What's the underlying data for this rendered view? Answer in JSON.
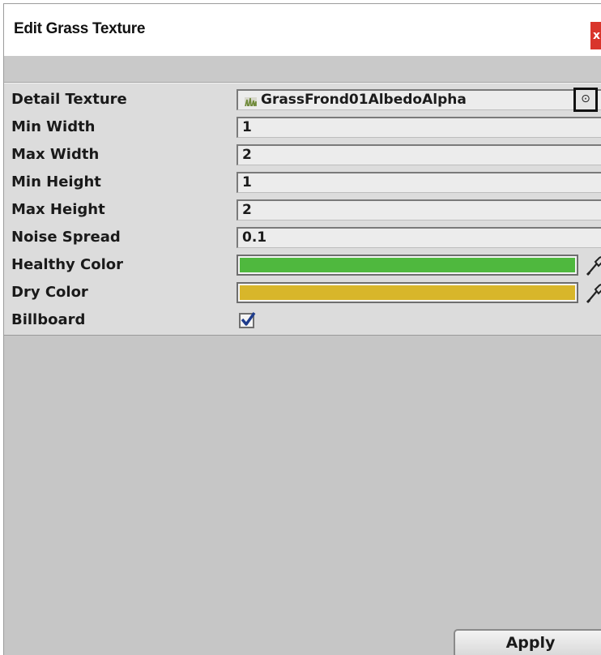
{
  "window": {
    "title": "Edit Grass Texture",
    "close_label": "x"
  },
  "properties": {
    "detail_texture": {
      "label": "Detail Texture",
      "value": "GrassFrond01AlbedoAlpha",
      "picker_icon": "object-picker-icon"
    },
    "min_width": {
      "label": "Min Width",
      "value": "1"
    },
    "max_width": {
      "label": "Max Width",
      "value": "2"
    },
    "min_height": {
      "label": "Min Height",
      "value": "1"
    },
    "max_height": {
      "label": "Max Height",
      "value": "2"
    },
    "noise_spread": {
      "label": "Noise Spread",
      "value": "0.1"
    },
    "healthy_color": {
      "label": "Healthy Color",
      "color": "#4fb83e",
      "icon": "eyedropper-icon"
    },
    "dry_color": {
      "label": "Dry Color",
      "color": "#d8b62a",
      "icon": "eyedropper-icon"
    },
    "billboard": {
      "label": "Billboard",
      "checked": true
    }
  },
  "footer": {
    "apply_label": "Apply"
  }
}
